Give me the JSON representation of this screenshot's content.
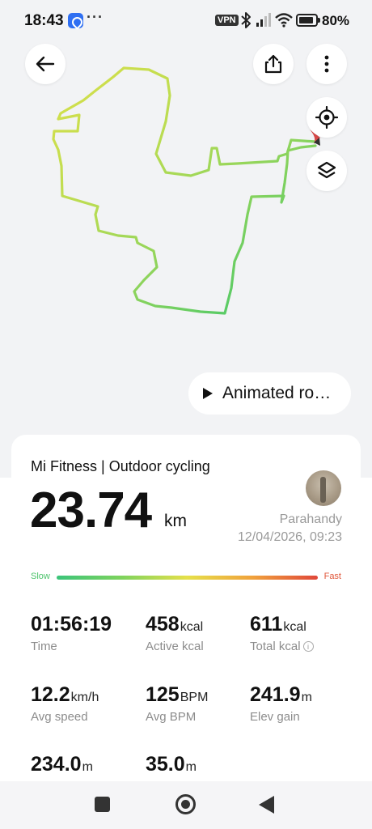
{
  "status_bar": {
    "time": "18:43",
    "dots": "···",
    "vpn_label": "VPN",
    "battery_percent": "80%"
  },
  "map": {
    "animated_route_label": "Animated ro…",
    "route_colors": [
      "#d8e04a",
      "#b9dc52",
      "#8fd45c",
      "#5fcc64",
      "#3ec470"
    ],
    "start_marker_color": "#d84848"
  },
  "activity": {
    "source_label": "Mi Fitness | Outdoor cycling",
    "distance_value": "23.74",
    "distance_unit": "km",
    "user_name": "Parahandy",
    "date_time": "12/04/2026, 09:23",
    "speed_legend": {
      "slow": "Slow",
      "fast": "Fast"
    },
    "stats": [
      {
        "value": "01:56:19",
        "unit": "",
        "label": "Time"
      },
      {
        "value": "458",
        "unit": "kcal",
        "label": "Active kcal"
      },
      {
        "value": "611",
        "unit": "kcal",
        "label": "Total kcal",
        "info": "i"
      },
      {
        "value": "12.2",
        "unit": "km/h",
        "label": "Avg speed"
      },
      {
        "value": "125",
        "unit": "BPM",
        "label": "Avg BPM"
      },
      {
        "value": "241.9",
        "unit": "m",
        "label": "Elev gain"
      },
      {
        "value": "234.0",
        "unit": "m",
        "label": ""
      },
      {
        "value": "35.0",
        "unit": "m",
        "label": ""
      }
    ]
  },
  "colors": {
    "accent_slow": "#4cc36b",
    "accent_fast": "#e0573b",
    "background": "#f2f3f5"
  }
}
